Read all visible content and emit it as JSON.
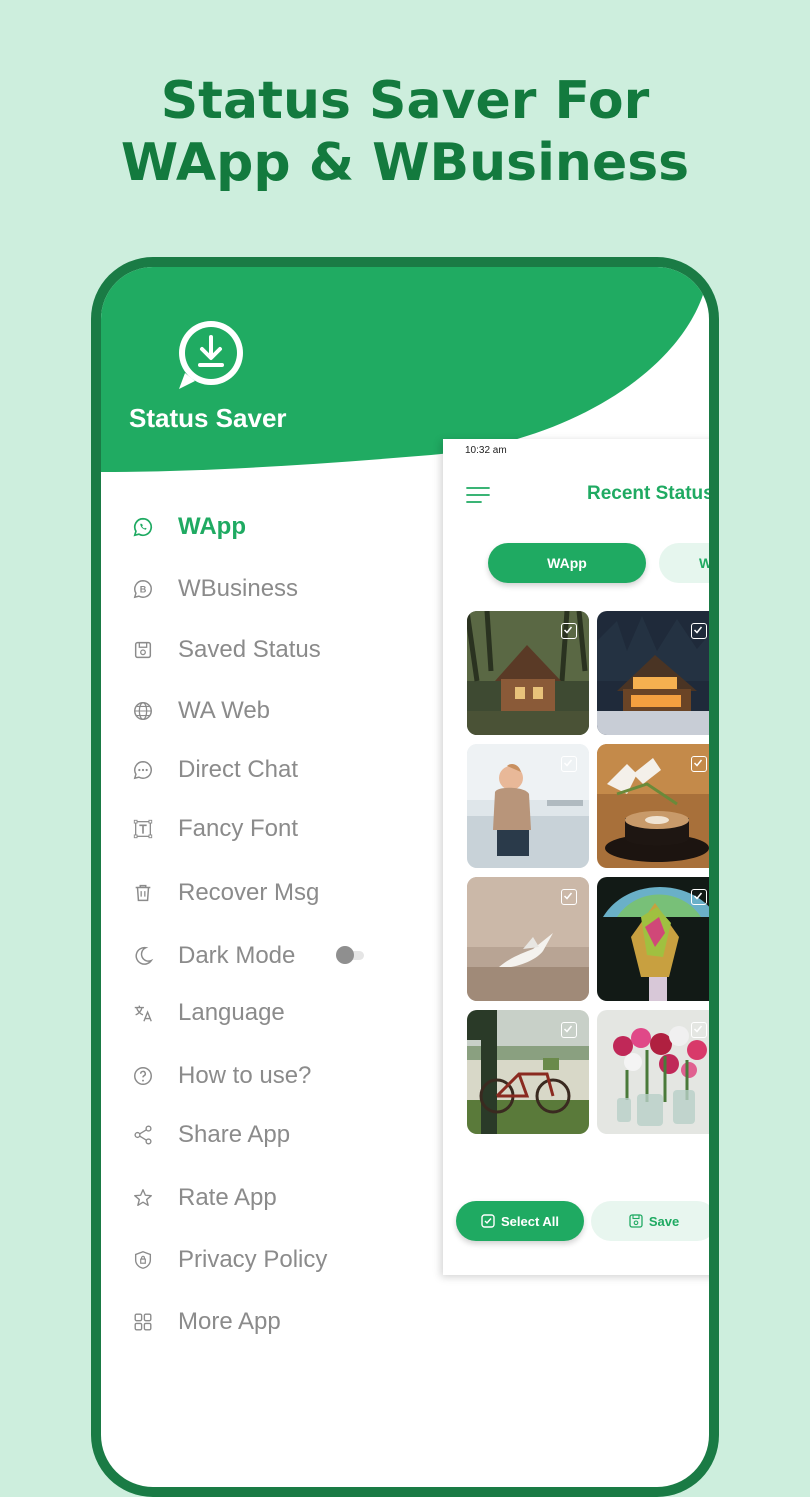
{
  "headline": {
    "line1": "Status Saver For",
    "line2": "WApp & WBusiness"
  },
  "drawer": {
    "app_name": "Status Saver",
    "items": [
      {
        "label": "WApp",
        "icon": "whatsapp-icon",
        "active": true
      },
      {
        "label": "WBusiness",
        "icon": "business-icon"
      },
      {
        "label": "Saved Status",
        "icon": "save-icon"
      },
      {
        "label": "WA Web",
        "icon": "globe-icon"
      },
      {
        "label": "Direct Chat",
        "icon": "chat-icon"
      },
      {
        "label": "Fancy Font",
        "icon": "text-icon"
      },
      {
        "label": "Recover Msg",
        "icon": "trash-icon"
      },
      {
        "label": "Dark Mode",
        "icon": "moon-icon",
        "toggle": false
      },
      {
        "label": "Language",
        "icon": "translate-icon"
      },
      {
        "label": "How to use?",
        "icon": "help-icon"
      },
      {
        "label": "Share App",
        "icon": "share-icon"
      },
      {
        "label": "Rate App",
        "icon": "star-icon"
      },
      {
        "label": "Privacy Policy",
        "icon": "shield-icon"
      },
      {
        "label": "More App",
        "icon": "grid-icon"
      }
    ]
  },
  "mini_screen": {
    "time": "10:32 am",
    "title": "Recent Status",
    "tabs": [
      "WApp",
      "WB"
    ],
    "thumbnails": [
      "cabin-forest",
      "cabin-night",
      "child-sink",
      "coffee-tulips",
      "white-bird",
      "rainbow-umbrella",
      "bicycle-tree",
      "flower-vases"
    ],
    "select_all_label": "Select All",
    "save_label": "Save"
  },
  "colors": {
    "background": "#cdeedd",
    "brand": "#1faa62",
    "dark_green": "#137a3e"
  }
}
